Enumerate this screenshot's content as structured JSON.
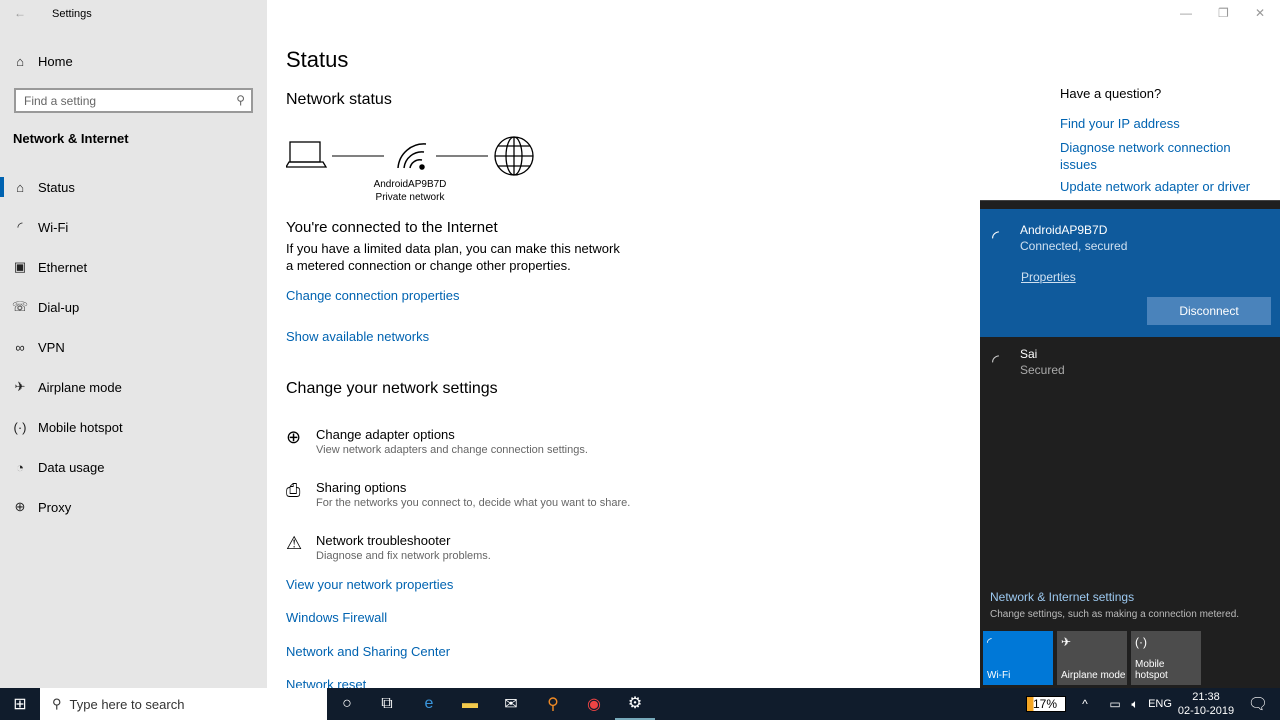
{
  "window": {
    "title": "Settings"
  },
  "sidebar": {
    "home": "Home",
    "search_placeholder": "Find a setting",
    "section": "Network & Internet",
    "items": [
      {
        "label": "Status",
        "icon": "home-status-icon"
      },
      {
        "label": "Wi-Fi",
        "icon": "wifi-icon"
      },
      {
        "label": "Ethernet",
        "icon": "ethernet-icon"
      },
      {
        "label": "Dial-up",
        "icon": "dialup-icon"
      },
      {
        "label": "VPN",
        "icon": "vpn-icon"
      },
      {
        "label": "Airplane mode",
        "icon": "airplane-icon"
      },
      {
        "label": "Mobile hotspot",
        "icon": "hotspot-icon"
      },
      {
        "label": "Data usage",
        "icon": "data-usage-icon"
      },
      {
        "label": "Proxy",
        "icon": "proxy-icon"
      }
    ]
  },
  "main": {
    "title": "Status",
    "network_status": "Network status",
    "network_name": "AndroidAP9B7D",
    "network_type": "Private network",
    "connected": "You're connected to the Internet",
    "connected_desc": "If you have a limited data plan, you can make this network a metered connection or change other properties.",
    "change_props": "Change connection properties",
    "show_networks": "Show available networks",
    "change_settings": "Change your network settings",
    "options": [
      {
        "title": "Change adapter options",
        "desc": "View network adapters and change connection settings."
      },
      {
        "title": "Sharing options",
        "desc": "For the networks you connect to, decide what you want to share."
      },
      {
        "title": "Network troubleshooter",
        "desc": "Diagnose and fix network problems."
      }
    ],
    "links": [
      "View your network properties",
      "Windows Firewall",
      "Network and Sharing Center",
      "Network reset"
    ]
  },
  "help": {
    "title": "Have a question?",
    "links": [
      "Find your IP address",
      "Diagnose network connection issues",
      "Update network adapter or driver"
    ]
  },
  "flyout": {
    "current": {
      "name": "AndroidAP9B7D",
      "status": "Connected, secured",
      "properties": "Properties",
      "disconnect": "Disconnect"
    },
    "other": {
      "name": "Sai",
      "status": "Secured"
    },
    "settings_link": "Network & Internet settings",
    "settings_desc": "Change settings, such as making a connection metered.",
    "tiles": [
      {
        "label": "Wi-Fi",
        "active": true
      },
      {
        "label": "Airplane mode",
        "active": false
      },
      {
        "label": "Mobile hotspot",
        "active": false
      }
    ]
  },
  "taskbar": {
    "search_placeholder": "Type here to search",
    "battery": "17%",
    "lang": "ENG",
    "time": "21:38",
    "date": "02-10-2019"
  },
  "colors": {
    "accent": "#0063b1",
    "flyout_selected": "#0f5a9c",
    "tile_active": "#0078d7"
  }
}
